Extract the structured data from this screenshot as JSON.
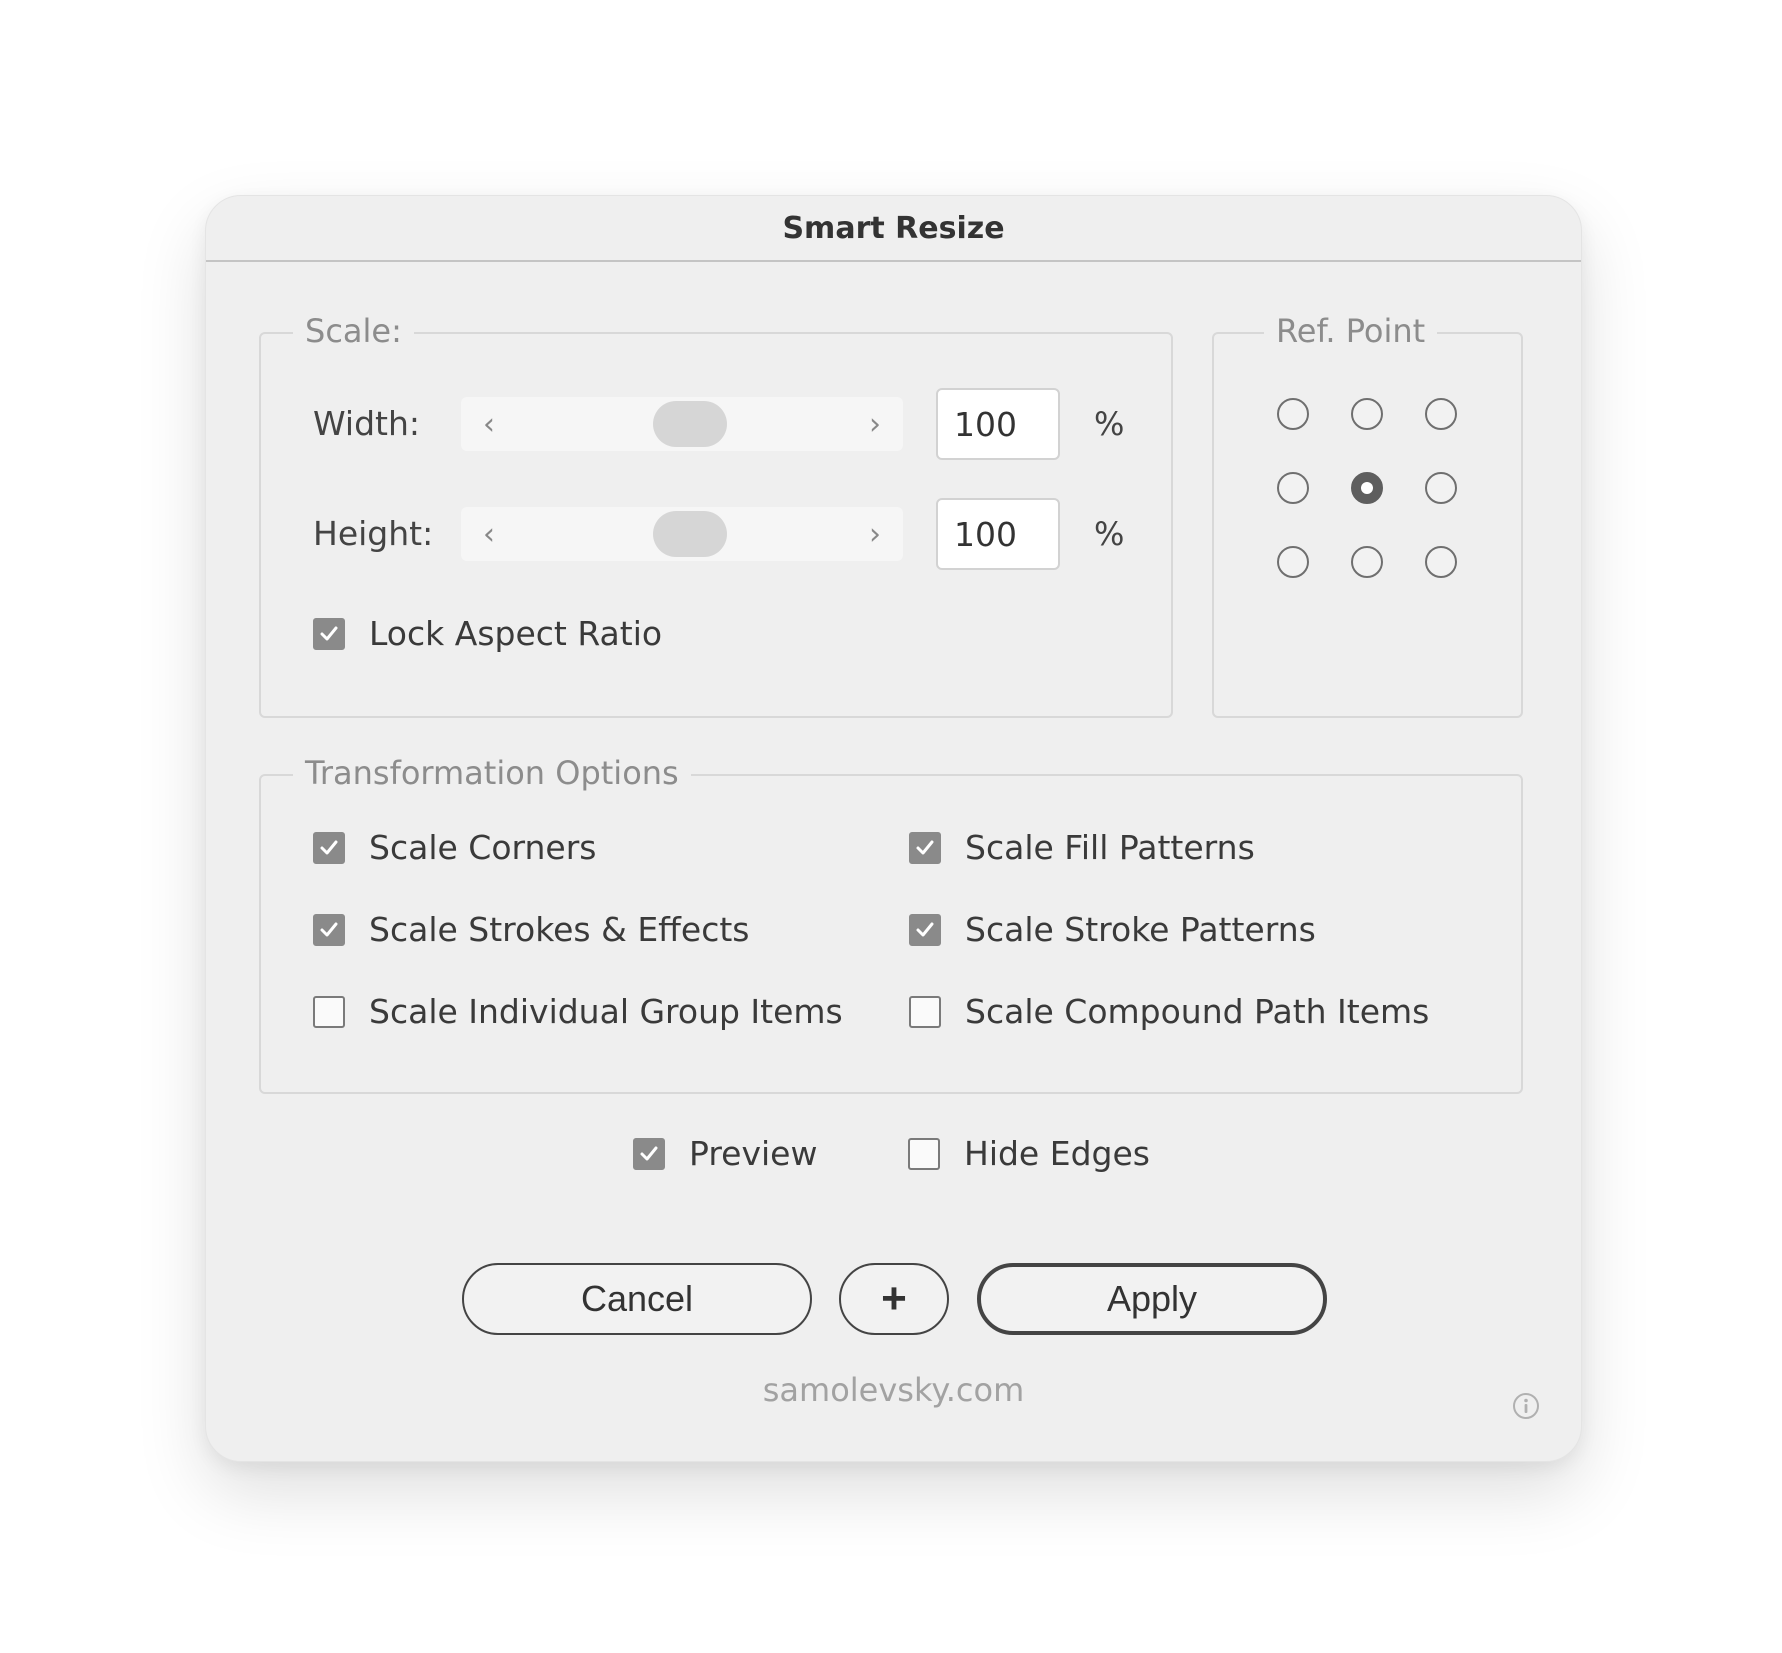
{
  "dialog": {
    "title": "Smart Resize"
  },
  "scale": {
    "legend": "Scale:",
    "width": {
      "label": "Width:",
      "value": "100",
      "unit": "%"
    },
    "height": {
      "label": "Height:",
      "value": "100",
      "unit": "%"
    },
    "lock_aspect_ratio": {
      "label": "Lock Aspect Ratio",
      "checked": true
    }
  },
  "ref_point": {
    "legend": "Ref. Point",
    "selected": "center"
  },
  "transformation": {
    "legend": "Transformation Options",
    "options": [
      {
        "label": "Scale Corners",
        "checked": true
      },
      {
        "label": "Scale Fill Patterns",
        "checked": true
      },
      {
        "label": "Scale Strokes & Effects",
        "checked": true
      },
      {
        "label": "Scale Stroke Patterns",
        "checked": true
      },
      {
        "label": "Scale Individual Group Items",
        "checked": false
      },
      {
        "label": "Scale Compound Path Items",
        "checked": false
      }
    ]
  },
  "preview": {
    "label": "Preview",
    "checked": true
  },
  "hide_edges": {
    "label": "Hide Edges",
    "checked": false
  },
  "buttons": {
    "cancel": "Cancel",
    "add": "+",
    "apply": "Apply"
  },
  "footer": {
    "link": "samolevsky.com"
  },
  "icons": {
    "slider_left": "chevron-left-icon",
    "slider_right": "chevron-right-icon",
    "info": "info-icon",
    "check": "checkmark-icon"
  }
}
